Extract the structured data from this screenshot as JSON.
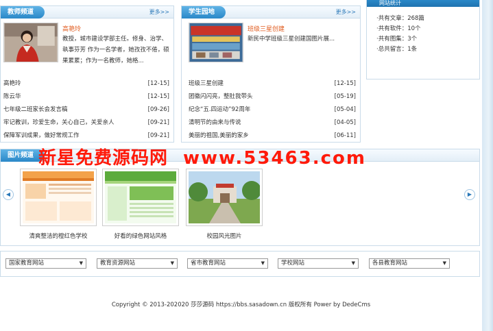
{
  "teacher_panel": {
    "tab": "教师频道",
    "more": "更多>>",
    "feature_title": "高艳玲",
    "feature_desc": "教授，城市建设学部主任。修身、治学、執事芬芳 作为一名学者，她孜孜不倦，硕果累累；作为一名教师，她格...",
    "items": [
      {
        "title": "高艳玲",
        "date": "[12-15]"
      },
      {
        "title": "陈云华",
        "date": "[12-15]"
      },
      {
        "title": "七年级二班家长会发言稿",
        "date": "[09-26]"
      },
      {
        "title": "牢记教训，珍爱生命，关心自己，关爱亲人",
        "date": "[09-21]"
      },
      {
        "title": "保障军训成果，做好常规工作",
        "date": "[09-21]"
      }
    ]
  },
  "student_panel": {
    "tab": "学生园地",
    "more": "更多>>",
    "feature_title": "班级三星创建",
    "feature_desc": "新民中学班级三星创建国图片展...",
    "items": [
      {
        "title": "班级三星创建",
        "date": "[12-15]"
      },
      {
        "title": "团徽闪闪亮，整肚我带头",
        "date": "[05-19]"
      },
      {
        "title": "纪念“五.四运动”92周年",
        "date": "[05-04]"
      },
      {
        "title": "清明节的由来与传说",
        "date": "[04-05]"
      },
      {
        "title": "美丽的祖国,美丽的家乡",
        "date": "[06-11]"
      }
    ]
  },
  "stats_panel": {
    "title": "网站统计",
    "lines": [
      "·共有文章：268篇",
      "·共有软件：10个",
      "·共有图集：3个",
      "·总共留言：1条"
    ]
  },
  "photo_panel": {
    "tab": "图片频道",
    "items": [
      {
        "caption": "清爽整洁的橙红色学校"
      },
      {
        "caption": "好看的绿色网站风格"
      },
      {
        "caption": "校园风光图片"
      }
    ]
  },
  "selects": [
    {
      "value": "国家教育网站"
    },
    {
      "value": "教育资源网站"
    },
    {
      "value": "省市教育网站"
    },
    {
      "value": "学校网站"
    },
    {
      "value": "各县教育网站"
    }
  ],
  "watermark": {
    "name": "新星免费源码网",
    "url": "www.53463.com"
  },
  "footer": "Copyright © 2013-202020 莎莎源码 https://bbs.sasadown.cn 版权所有 Power by DedeCms",
  "colors": {
    "accent": "#2a88c8",
    "feature_title": "#e05a1c",
    "watermark": "#ff1a0a"
  }
}
